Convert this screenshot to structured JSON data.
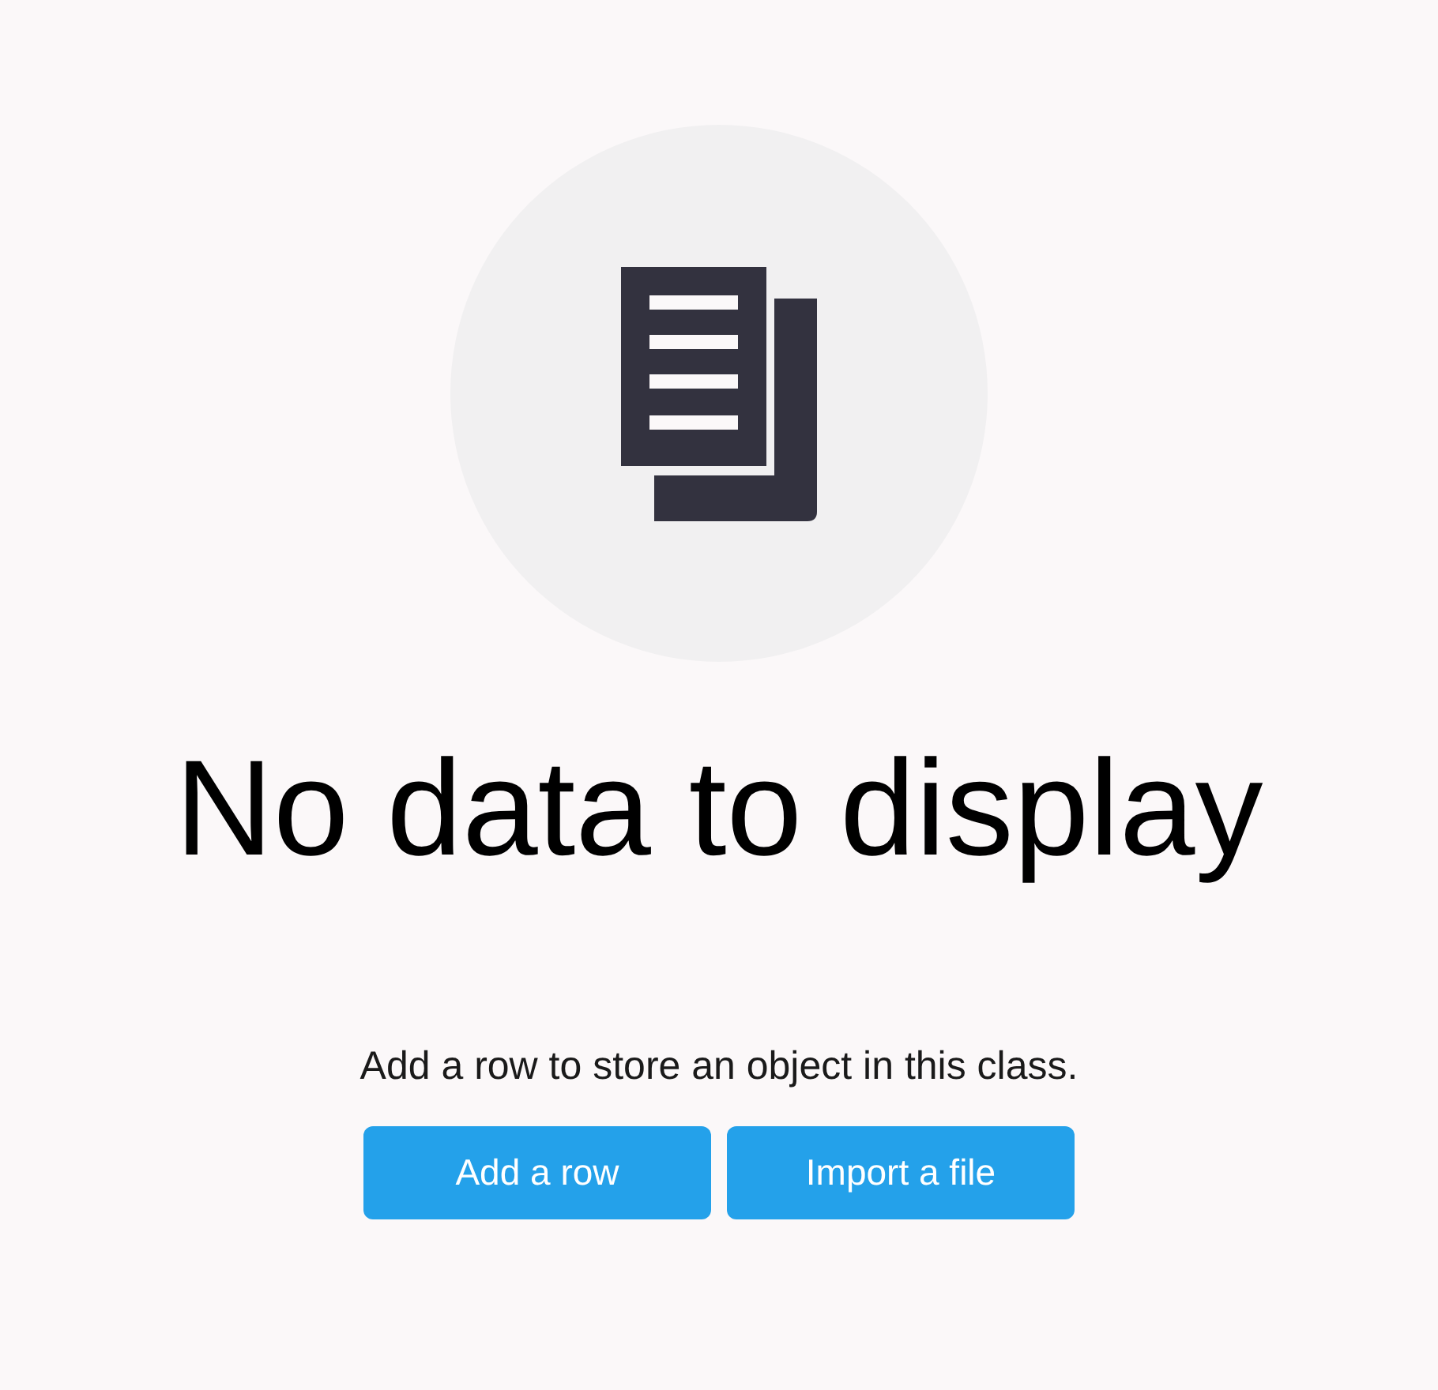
{
  "empty_state": {
    "title": "No data to display",
    "message": "Add a row to store an object in this class.",
    "buttons": [
      {
        "label": "Add a row"
      },
      {
        "label": "Import a file"
      }
    ]
  }
}
